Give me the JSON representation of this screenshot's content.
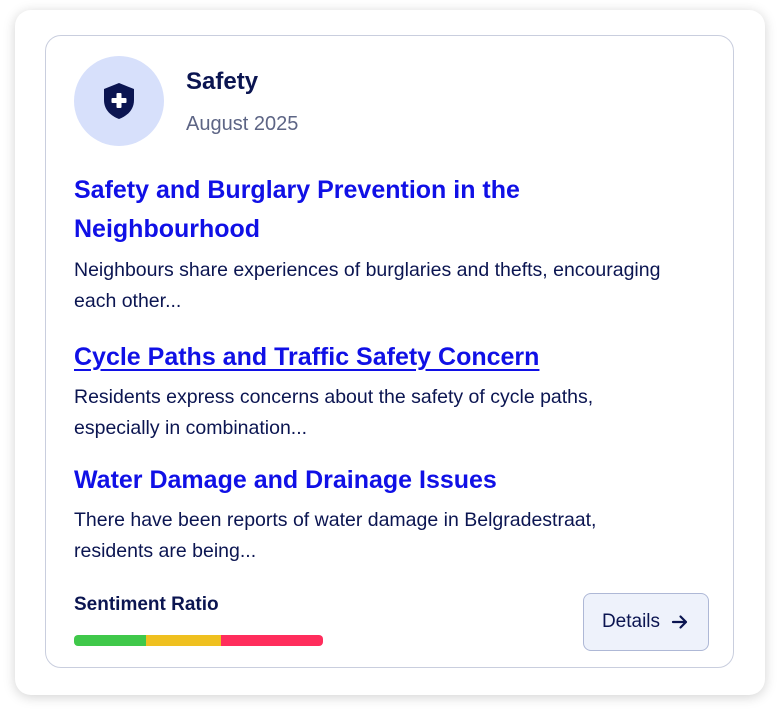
{
  "card": {
    "icon": "shield-plus-icon",
    "title": "Safety",
    "date": "August 2025"
  },
  "topics": [
    {
      "title": "Safety and Burglary Prevention in the Neighbourhood",
      "description": "Neighbours share experiences of burglaries and thefts, encouraging each other..."
    },
    {
      "title": "Cycle Paths and Traffic Safety Concern",
      "description": "Residents express concerns about the safety of cycle paths, especially in combination..."
    },
    {
      "title": "Water Damage and Drainage Issues",
      "description": "There have been reports of water damage in Belgradestraat, residents are being..."
    }
  ],
  "sentiment": {
    "label": "Sentiment Ratio",
    "segments": [
      {
        "name": "positive",
        "fraction": 0.29,
        "color": "#3fc84a"
      },
      {
        "name": "neutral",
        "fraction": 0.3,
        "color": "#efc01f"
      },
      {
        "name": "negative",
        "fraction": 0.41,
        "color": "#ff2d5c"
      }
    ]
  },
  "details_button": {
    "label": "Details",
    "icon": "arrow-right-icon"
  },
  "colors": {
    "accent": "#1010e6",
    "navy": "#0b1551"
  }
}
